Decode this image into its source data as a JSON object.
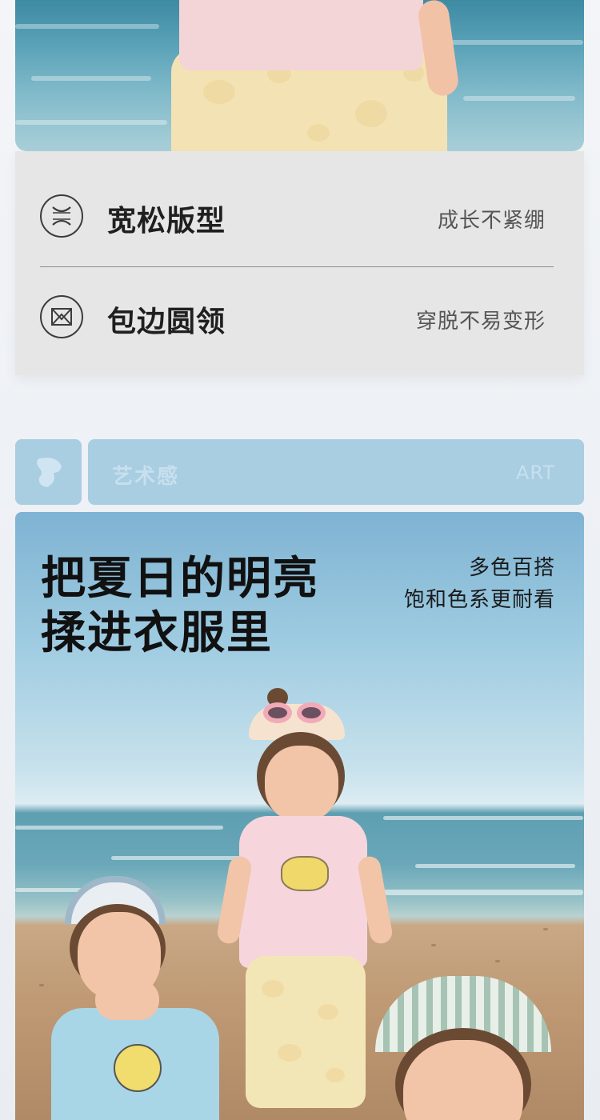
{
  "features": [
    {
      "title": "宽松版型",
      "subtitle": "成长不紧绷",
      "icon": "loose-fit-icon"
    },
    {
      "title": "包边圆领",
      "subtitle": "穿脱不易变形",
      "icon": "round-collar-icon"
    }
  ],
  "section": {
    "title": "艺术感",
    "title_en": "ART",
    "icon": "brand-logo-icon",
    "color": "#a9cde1"
  },
  "hero": {
    "headline_line1": "把夏日的明亮",
    "headline_line2": "揉进衣服里",
    "tagline_line1": "多色百搭",
    "tagline_line2": "饱和色系更耐看"
  }
}
